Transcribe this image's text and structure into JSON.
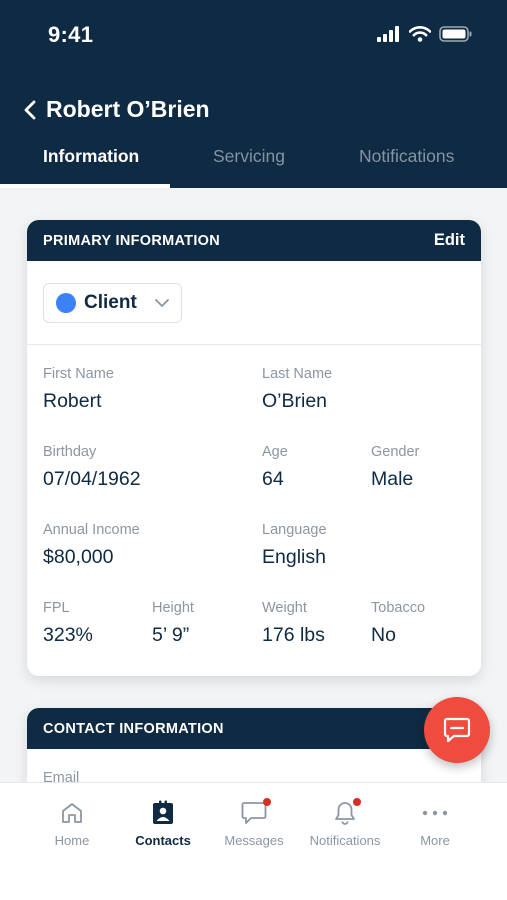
{
  "status_bar": {
    "time": "9:41"
  },
  "header": {
    "contact_name": "Robert O’Brien"
  },
  "tabs": [
    {
      "label": "Information",
      "active": true
    },
    {
      "label": "Servicing",
      "active": false
    },
    {
      "label": "Notifications",
      "active": false
    }
  ],
  "primary_info": {
    "title": "PRIMARY INFORMATION",
    "edit_label": "Edit",
    "contact_type": "Client",
    "fields": {
      "first_name": {
        "label": "First Name",
        "value": "Robert"
      },
      "last_name": {
        "label": "Last Name",
        "value": "O’Brien"
      },
      "birthday": {
        "label": "Birthday",
        "value": "07/04/1962"
      },
      "age": {
        "label": "Age",
        "value": "64"
      },
      "gender": {
        "label": "Gender",
        "value": "Male"
      },
      "annual_income": {
        "label": "Annual Income",
        "value": "$80,000"
      },
      "language": {
        "label": "Language",
        "value": "English"
      },
      "fpl": {
        "label": "FPL",
        "value": "323%"
      },
      "height": {
        "label": "Height",
        "value": "5’ 9”"
      },
      "weight": {
        "label": "Weight",
        "value": "176 lbs"
      },
      "tobacco": {
        "label": "Tobacco",
        "value": "No"
      }
    }
  },
  "contact_info": {
    "title": "CONTACT INFORMATION",
    "email_label": "Email"
  },
  "bottom_nav": {
    "home": "Home",
    "contacts": "Contacts",
    "messages": "Messages",
    "notifications": "Notifications",
    "more": "More"
  },
  "colors": {
    "navy": "#0f2a43",
    "accent_blue": "#3b82f6",
    "fab_red": "#ef4b3f",
    "badge_red": "#d92d20"
  }
}
